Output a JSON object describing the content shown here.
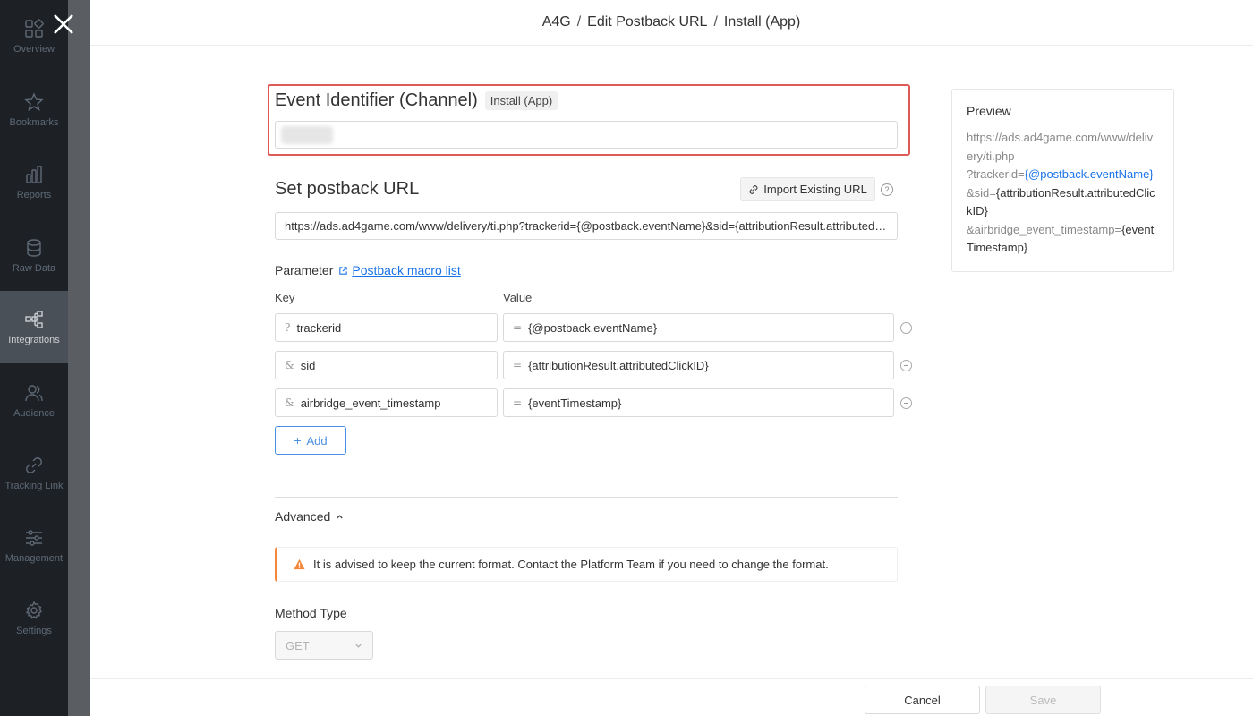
{
  "sidebar": {
    "items": [
      {
        "label": "Overview",
        "icon": "overview-icon",
        "active": false
      },
      {
        "label": "Bookmarks",
        "icon": "star-icon",
        "active": false
      },
      {
        "label": "Reports",
        "icon": "bar-chart-icon",
        "active": false
      },
      {
        "label": "Raw Data",
        "icon": "database-icon",
        "active": false
      },
      {
        "label": "Integrations",
        "icon": "integrations-icon",
        "active": true
      },
      {
        "label": "Audience",
        "icon": "audience-icon",
        "active": false
      },
      {
        "label": "Tracking Link",
        "icon": "link-icon",
        "active": false
      },
      {
        "label": "Management",
        "icon": "sliders-icon",
        "active": false
      },
      {
        "label": "Settings",
        "icon": "gear-icon",
        "active": false
      }
    ]
  },
  "header": {
    "crumbs": [
      "A4G",
      "Edit Postback URL",
      "Install (App)"
    ],
    "separator": "/"
  },
  "event_identifier": {
    "title": "Event Identifier (Channel)",
    "tag": "Install (App)"
  },
  "postback": {
    "title": "Set postback URL",
    "import_label": "Import Existing URL",
    "url_value": "https://ads.ad4game.com/www/delivery/ti.php?trackerid={@postback.eventName}&sid={attributionResult.attributedClickID}&airbridge_event_timestamp={eventTimestamp}"
  },
  "parameters": {
    "label": "Parameter",
    "macro_link": "Postback macro list",
    "key_header": "Key",
    "value_header": "Value",
    "rows": [
      {
        "prefix": "?",
        "key": "trackerid",
        "value": "{@postback.eventName}"
      },
      {
        "prefix": "&",
        "key": "sid",
        "value": "{attributionResult.attributedClickID}"
      },
      {
        "prefix": "&",
        "key": "airbridge_event_timestamp",
        "value": "{eventTimestamp}"
      }
    ],
    "add_label": "Add"
  },
  "advanced": {
    "label": "Advanced",
    "alert": "It is advised to keep the current format. Contact the Platform Team if you need to change the format.",
    "method_label": "Method Type",
    "method_value": "GET"
  },
  "footer": {
    "cancel": "Cancel",
    "save": "Save"
  },
  "preview": {
    "title": "Preview",
    "base": "https://ads.ad4game.com/www/delivery/ti.php",
    "p1_key": "?trackerid=",
    "p1_val": "{@postback.eventName}",
    "p2_key": "&sid=",
    "p2_val": "{attributionResult.attributedClickID}",
    "p3_key": "&airbridge_event_timestamp=",
    "p3_val": "{eventTimestamp}"
  },
  "colors": {
    "accent": "#1a73e8",
    "highlight": "#e05a5a",
    "warning": "#f5873a",
    "sidebar_bg": "#1d2126"
  }
}
